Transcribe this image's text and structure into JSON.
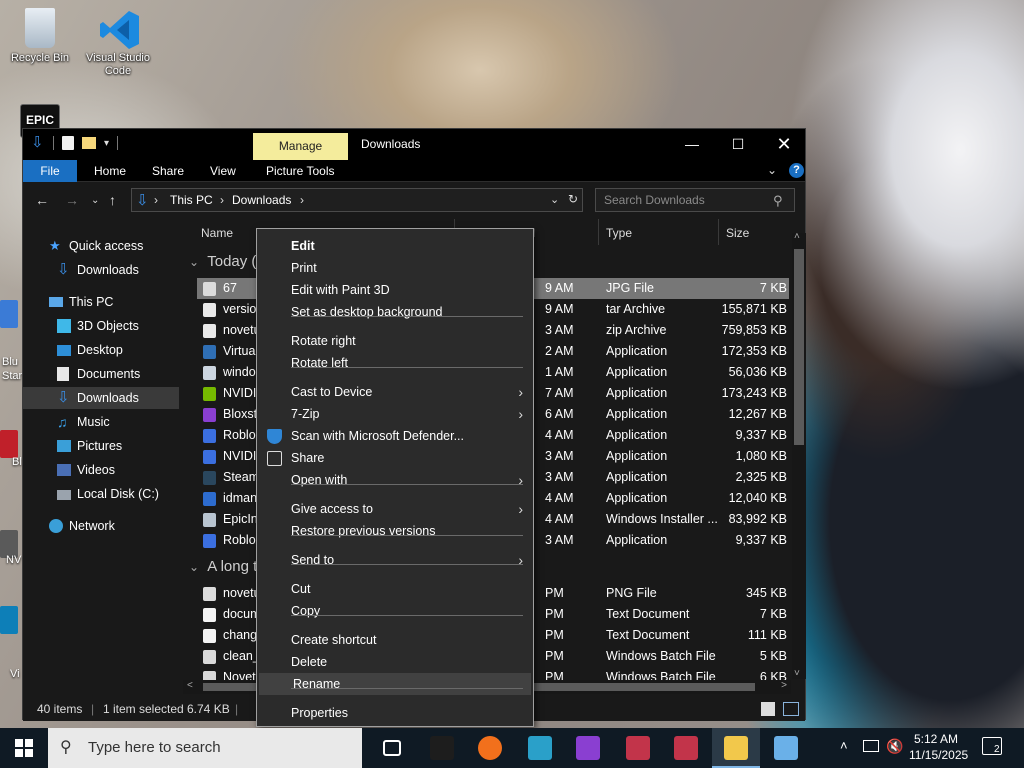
{
  "desktop": {
    "icons": [
      {
        "label": "Recycle Bin",
        "icon": "recycle-bin-icon"
      },
      {
        "label": "Visual Studio Code",
        "icon": "vscode-icon"
      },
      {
        "label": "EPIC",
        "icon": "epic-games-icon"
      }
    ],
    "edge_labels": [
      "Blu",
      "Star",
      "Bl",
      "NV",
      "Vi",
      "Ep",
      "L"
    ]
  },
  "window": {
    "manage_tab": "Manage",
    "title": "Downloads",
    "ribbon_tabs": [
      "File",
      "Home",
      "Share",
      "View",
      "Picture Tools"
    ],
    "address": {
      "root": "This PC",
      "folder": "Downloads"
    },
    "search_placeholder": "Search Downloads",
    "nav": [
      {
        "label": "Quick access",
        "icon": "star-icon"
      },
      {
        "label": "Downloads",
        "icon": "download-arrow-icon"
      },
      {
        "label": "This PC",
        "icon": "computer-icon"
      },
      {
        "label": "3D Objects",
        "icon": "cube-icon"
      },
      {
        "label": "Desktop",
        "icon": "desktop-icon"
      },
      {
        "label": "Documents",
        "icon": "documents-icon"
      },
      {
        "label": "Downloads",
        "icon": "download-arrow-icon"
      },
      {
        "label": "Music",
        "icon": "music-icon"
      },
      {
        "label": "Pictures",
        "icon": "pictures-icon"
      },
      {
        "label": "Videos",
        "icon": "videos-icon"
      },
      {
        "label": "Local Disk (C:)",
        "icon": "drive-icon"
      },
      {
        "label": "Network",
        "icon": "network-icon"
      }
    ],
    "columns": {
      "name": "Name",
      "date": "Date modified",
      "type": "Type",
      "size": "Size"
    },
    "groups": {
      "today": "Today (1",
      "long_ago": "A long t"
    },
    "today_rows": [
      {
        "name": "67",
        "date": "9 AM",
        "type": "JPG File",
        "size": "7 KB",
        "icon": "image-file-icon"
      },
      {
        "name": "version",
        "date": "9 AM",
        "type": "tar Archive",
        "size": "155,871 KB",
        "icon": "archive-icon"
      },
      {
        "name": "novetu",
        "date": "3 AM",
        "type": "zip Archive",
        "size": "759,853 KB",
        "icon": "zip-icon"
      },
      {
        "name": "Virtual",
        "date": "2 AM",
        "type": "Application",
        "size": "172,353 KB",
        "icon": "vbox-icon"
      },
      {
        "name": "windo",
        "date": "1 AM",
        "type": "Application",
        "size": "56,036 KB",
        "icon": "installer-icon"
      },
      {
        "name": "NVIDIA",
        "date": "7 AM",
        "type": "Application",
        "size": "173,243 KB",
        "icon": "nvidia-icon"
      },
      {
        "name": "Bloxstr",
        "date": "6 AM",
        "type": "Application",
        "size": "12,267 KB",
        "icon": "bloxstrap-icon"
      },
      {
        "name": "Roblox",
        "date": "4 AM",
        "type": "Application",
        "size": "9,337 KB",
        "icon": "roblox-icon"
      },
      {
        "name": "NVIDIA",
        "date": "3 AM",
        "type": "Application",
        "size": "1,080 KB",
        "icon": "nvidia-download-icon"
      },
      {
        "name": "Steam",
        "date": "3 AM",
        "type": "Application",
        "size": "2,325 KB",
        "icon": "steam-icon"
      },
      {
        "name": "idman",
        "date": "4 AM",
        "type": "Application",
        "size": "12,040 KB",
        "icon": "idm-icon"
      },
      {
        "name": "EpicIns",
        "date": "4 AM",
        "type": "Windows Installer ...",
        "size": "83,992 KB",
        "icon": "msi-icon"
      },
      {
        "name": "Roblox",
        "date": "3 AM",
        "type": "Application",
        "size": "9,337 KB",
        "icon": "roblox-icon"
      }
    ],
    "old_rows": [
      {
        "name": "novetu",
        "date": "PM",
        "type": "PNG File",
        "size": "345 KB",
        "icon": "image-file-icon"
      },
      {
        "name": "docum",
        "date": "PM",
        "type": "Text Document",
        "size": "7 KB",
        "icon": "text-file-icon"
      },
      {
        "name": "change",
        "date": "PM",
        "type": "Text Document",
        "size": "111 KB",
        "icon": "text-file-icon"
      },
      {
        "name": "clean_",
        "date": "PM",
        "type": "Windows Batch File",
        "size": "5 KB",
        "icon": "batch-file-icon"
      },
      {
        "name": "Novetu",
        "date": "PM",
        "type": "Windows Batch File",
        "size": "6 KB",
        "icon": "batch-file-icon"
      }
    ],
    "status": {
      "items": "40 items",
      "selected": "1 item selected",
      "size": "6.74 KB"
    }
  },
  "context_menu": {
    "items": [
      {
        "label": "Edit",
        "bold": true
      },
      {
        "label": "Print"
      },
      {
        "label": "Edit with Paint 3D"
      },
      {
        "label": "Set as desktop background"
      },
      {
        "label": "Rotate right"
      },
      {
        "label": "Rotate left"
      },
      {
        "label": "Cast to Device",
        "submenu": true
      },
      {
        "label": "7-Zip",
        "submenu": true
      },
      {
        "label": "Scan with Microsoft Defender...",
        "icon": "defender-shield-icon"
      },
      {
        "label": "Share",
        "icon": "share-icon"
      },
      {
        "label": "Open with",
        "submenu": true
      },
      {
        "label": "Give access to",
        "submenu": true
      },
      {
        "label": "Restore previous versions"
      },
      {
        "label": "Send to",
        "submenu": true
      },
      {
        "label": "Cut"
      },
      {
        "label": "Copy"
      },
      {
        "label": "Create shortcut"
      },
      {
        "label": "Delete"
      },
      {
        "label": "Rename",
        "hover": true
      },
      {
        "label": "Properties"
      }
    ]
  },
  "taskbar": {
    "search_placeholder": "Type here to search",
    "apps": [
      "task-view-icon",
      "epic-games-icon",
      "firefox-icon",
      "code-editor-icon",
      "bloxstrap-icon",
      "app-n-icon",
      "app-n-icon",
      "file-explorer-icon",
      "paint-icon"
    ],
    "time": "5:12 AM",
    "date": "11/15/2025",
    "notifications": "2"
  },
  "colors": {
    "accent": "#1a6fc2",
    "manage_tab": "#f4ec9c",
    "window_bg": "#191919",
    "menu_bg": "#2b2b2b",
    "selection": "#777777"
  }
}
